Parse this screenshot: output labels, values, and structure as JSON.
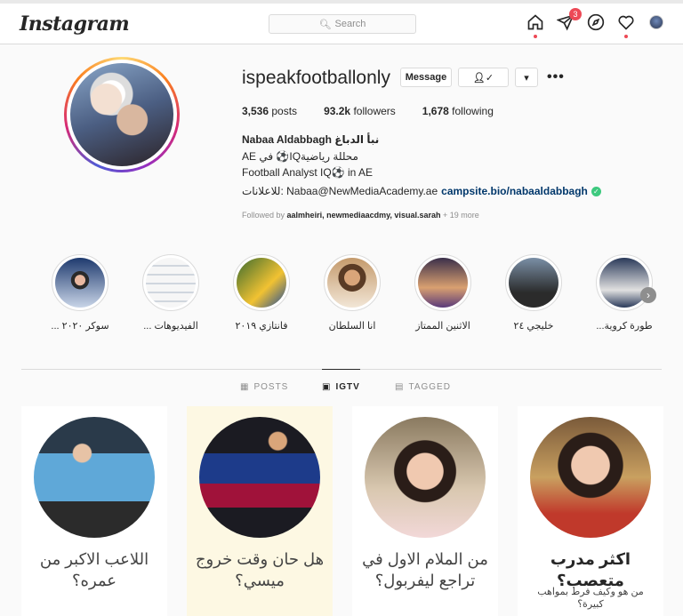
{
  "header": {
    "logo": "Instagram",
    "search_placeholder": "Search",
    "activity_badge": "3"
  },
  "profile": {
    "username": "ispeakfootballonly",
    "message_label": "Message",
    "stats": {
      "posts_count": "3,536",
      "posts_label": "posts",
      "followers_count": "93.2k",
      "followers_label": "followers",
      "following_count": "1,678",
      "following_label": "following"
    },
    "full_name": "Nabaa Aldabbagh نبأ الدباغ",
    "bio_line1": "AE في ⚽IQمحللة رياضية",
    "bio_line2": "Football Analyst IQ⚽ in AE",
    "bio_line3": "للاعلانات: Nabaa@NewMediaAcademy.ae",
    "bio_link": "campsite.bio/nabaaldabbagh",
    "followed_prefix": "Followed by",
    "followed_names": "aalmheiri, newmediaacdmy, visual.sarah",
    "followed_more": "+ 19 more"
  },
  "highlights": [
    {
      "label": "... سوكر ٢٠٢٠",
      "color_a": "#1e3a6e",
      "color_b": "#c9d5e8"
    },
    {
      "label": "... الفيديوهات",
      "color_a": "#f2f2f2",
      "color_b": "#9aa6b6"
    },
    {
      "label": "فانتازي ٢٠١٩",
      "color_a": "#3b6b2f",
      "color_b": "#f1c232"
    },
    {
      "label": "انا السلطان",
      "color_a": "#c49a6c",
      "color_b": "#5a3b25"
    },
    {
      "label": "الاثنين الممتاز",
      "color_a": "#3a2f4a",
      "color_b": "#d9a070"
    },
    {
      "label": "خليجي ٢٤",
      "color_a": "#7a8fa6",
      "color_b": "#2b2b2b"
    },
    {
      "label": "...طورة كروية",
      "color_a": "#2a3a5a",
      "color_b": "#e0e0e0"
    }
  ],
  "tabs": {
    "posts": "POSTS",
    "igtv": "IGTV",
    "tagged": "TAGGED"
  },
  "igtv": [
    {
      "title": "اللاعب الاكبر من عمره؟",
      "subtitle": "",
      "bg": "#ffffff"
    },
    {
      "title": "هل حان وقت خروج ميسي؟",
      "subtitle": "",
      "bg": "#fdf8e3"
    },
    {
      "title": "من الملام الاول في تراجع ليفربول؟",
      "subtitle": "",
      "bg": "#ffffff"
    },
    {
      "title": "اكثر مدرب متعصب؟",
      "subtitle": "من هو وكيف فرط بمواهب كبيرة؟",
      "bg": "#ffffff"
    }
  ]
}
